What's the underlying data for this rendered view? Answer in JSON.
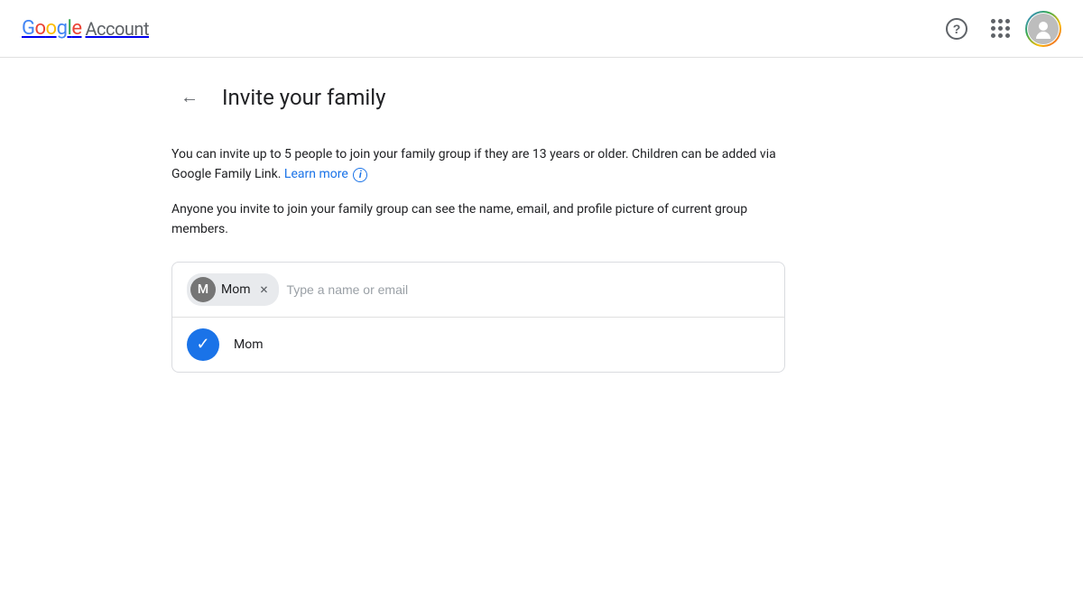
{
  "header": {
    "logo": {
      "letters": [
        "G",
        "o",
        "o",
        "g",
        "l",
        "e"
      ],
      "account_label": "Account"
    },
    "help_tooltip": "Help",
    "apps_tooltip": "Google apps",
    "avatar_tooltip": "Google Account"
  },
  "page": {
    "back_label": "←",
    "title": "Invite your family",
    "description1": "You can invite up to 5 people to join your family group if they are 13 years or older. Children can be added via Google Family Link.",
    "learn_more_label": "Learn more",
    "description2": "Anyone you invite to join your family group can see the name, email, and profile picture of current group members."
  },
  "invite": {
    "chip": {
      "initial": "M",
      "name": "Mom",
      "close_label": "×"
    },
    "input_placeholder": "Type a name or email",
    "dropdown": {
      "items": [
        {
          "name": "Mom",
          "checked": true
        }
      ]
    }
  }
}
